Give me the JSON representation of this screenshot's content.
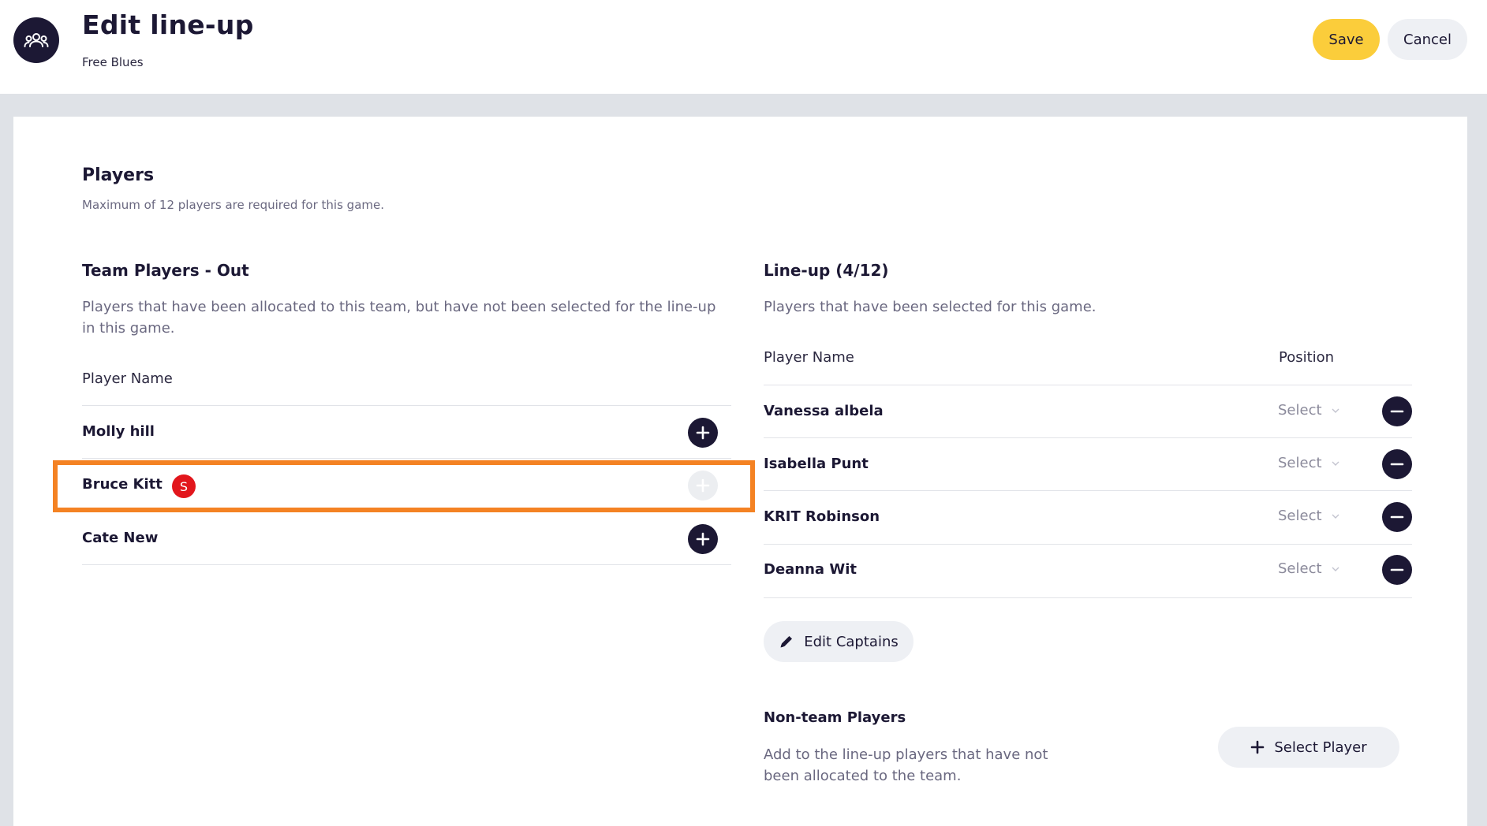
{
  "header": {
    "title": "Edit line-up",
    "subtitle": "Free Blues",
    "save_label": "Save",
    "cancel_label": "Cancel"
  },
  "players_section": {
    "title": "Players",
    "description": "Maximum of 12 players are required for this game."
  },
  "out_list": {
    "title": "Team Players - Out",
    "description": "Players that have been allocated to this team, but have not been selected for the line-up in this game.",
    "column_header": "Player Name",
    "players": [
      {
        "name": "Molly hill",
        "badge": "",
        "add_enabled": true
      },
      {
        "name": "Bruce Kitt",
        "badge": "S",
        "add_enabled": false
      },
      {
        "name": "Cate New",
        "badge": "",
        "add_enabled": true
      }
    ]
  },
  "lineup": {
    "title": "Line-up (4/12)",
    "description": "Players that have been selected for this game.",
    "column_player": "Player Name",
    "column_position": "Position",
    "players": [
      {
        "name": "Vanessa albela",
        "position": "Select"
      },
      {
        "name": "Isabella Punt",
        "position": "Select"
      },
      {
        "name": "KRIT Robinson",
        "position": "Select"
      },
      {
        "name": "Deanna Wit",
        "position": "Select"
      }
    ],
    "edit_captains_label": "Edit Captains"
  },
  "non_team": {
    "title": "Non-team Players",
    "description": "Add to the line-up players that have not been allocated to the team.",
    "select_player_label": "Select Player"
  },
  "colors": {
    "primary_dark": "#1c1834",
    "save_yellow": "#fbcd3b",
    "highlight_orange": "#f48223",
    "sub_badge_red": "#e2161c"
  }
}
